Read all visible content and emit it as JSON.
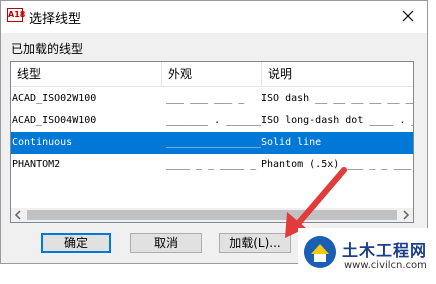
{
  "window": {
    "title": "选择线型",
    "icon_text": "A18"
  },
  "section_label": "已加载的线型",
  "table": {
    "columns": [
      "线型",
      "外观",
      "说明"
    ],
    "rows": [
      {
        "name": "ACAD_ISO02W100",
        "appearance": "___ ___ ___ _",
        "description": "ISO dash __ __ __ __ __ __",
        "selected": false
      },
      {
        "name": "ACAD_ISO04W100",
        "appearance": "_______ . _______",
        "description": "ISO long-dash dot ____ . ____",
        "selected": false
      },
      {
        "name": "Continuous",
        "appearance": "________________",
        "description": "Solid line",
        "selected": true
      },
      {
        "name": "PHANTOM2",
        "appearance": "____ _ _ ____ _ _",
        "description": "Phantom (.5x) ___ _ _ ___",
        "selected": false
      }
    ]
  },
  "buttons": {
    "ok": "确定",
    "cancel": "取消",
    "load": "加载(L)..."
  },
  "watermark": {
    "title": "土木工程网",
    "url": "www.civilcn.com"
  },
  "colors": {
    "selection": "#0078d7",
    "arrow": "#e23b3b",
    "watermark_text": "#1a3f8a"
  }
}
